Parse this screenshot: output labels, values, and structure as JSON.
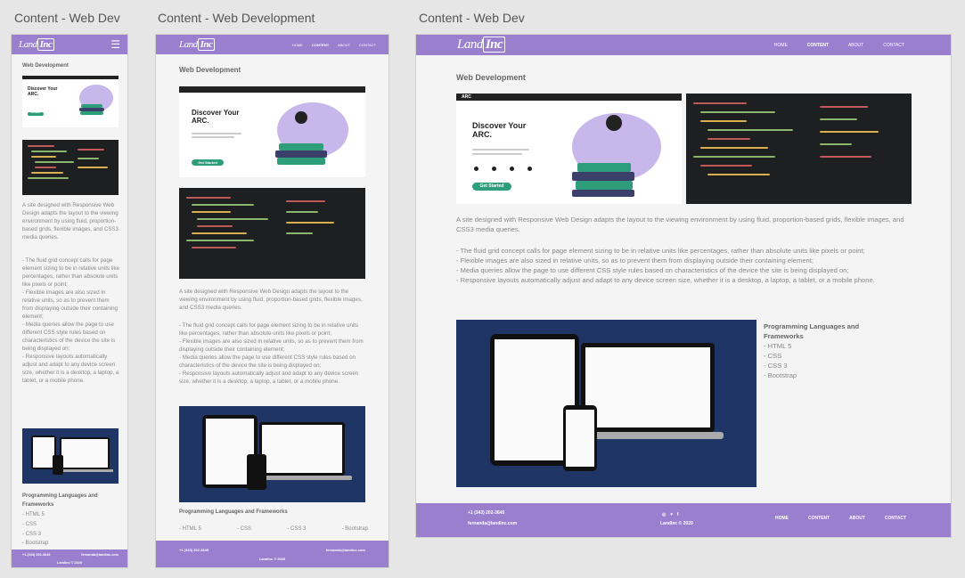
{
  "frames": {
    "small": {
      "title": "Content - Web Dev"
    },
    "medium": {
      "title": "Content - Web Development"
    },
    "large": {
      "title": "Content - Web Dev"
    }
  },
  "brand": {
    "logo_land": "Land",
    "logo_inc": "Inc"
  },
  "nav": {
    "home": "HOME",
    "content": "CONTENT",
    "about": "ABOUT",
    "contact": "CONTACT"
  },
  "page": {
    "heading": "Web Development",
    "hero_heading": "Discover Your ARC.",
    "hero_button": "Get Started",
    "hero_brand": "ARC",
    "intro": "A site designed with Responsive Web Design adapts the layout to the viewing environment by using fluid, proportion-based grids, flexible images, and CSS3 media queries.",
    "bullets": [
      "- The fluid grid concept calls for page element sizing to be in relative units like percentages, rather than absolute units like pixels or point;",
      "- Flexible images are also sized in relative units, so as to prevent them from displaying outside their containing element;",
      "- Media queries allow the page to use different CSS style rules based on characteristics of the device the site is being displayed on;",
      "- Responsive layouts automatically adjust and adapt to any device screen size, whether it is a desktop, a laptop, a tablet, or a mobile phone."
    ],
    "languages_heading": "Programming Languages and Frameworks",
    "languages": [
      "- HTML 5",
      "- CSS",
      "- CSS 3",
      "- Bootstrap"
    ]
  },
  "footer": {
    "phone": "+1 (343) 202-3645",
    "email": "fernanda@landinc.com",
    "copyright": "LandInc © 2020"
  },
  "colors": {
    "nav": "#9a7fcf",
    "accent": "#2e9e7a",
    "code_bg": "#1d1f21",
    "devices_bg": "#1f3566"
  }
}
